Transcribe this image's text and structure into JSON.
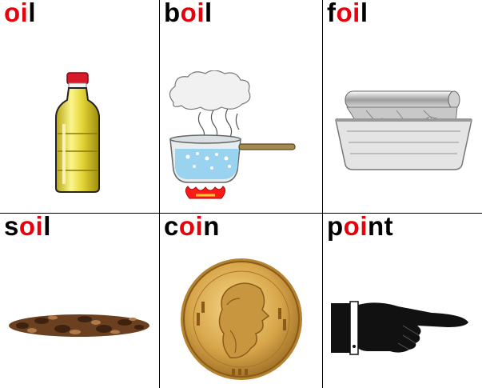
{
  "colors": {
    "letters": "#000000",
    "highlight": "#e8000b"
  },
  "cards": [
    {
      "word": "oil",
      "before": "",
      "highlight": "oi",
      "after": "l",
      "picture": "oil-bottle"
    },
    {
      "word": "boil",
      "before": "b",
      "highlight": "oi",
      "after": "l",
      "picture": "boiling-pot"
    },
    {
      "word": "foil",
      "before": "f",
      "highlight": "oi",
      "after": "l",
      "picture": "foil-tray"
    },
    {
      "word": "soil",
      "before": "s",
      "highlight": "oi",
      "after": "l",
      "picture": "soil-pile"
    },
    {
      "word": "coin",
      "before": "c",
      "highlight": "oi",
      "after": "n",
      "picture": "gold-coin"
    },
    {
      "word": "point",
      "before": "p",
      "highlight": "oi",
      "after": "nt",
      "picture": "pointing-hand"
    }
  ]
}
